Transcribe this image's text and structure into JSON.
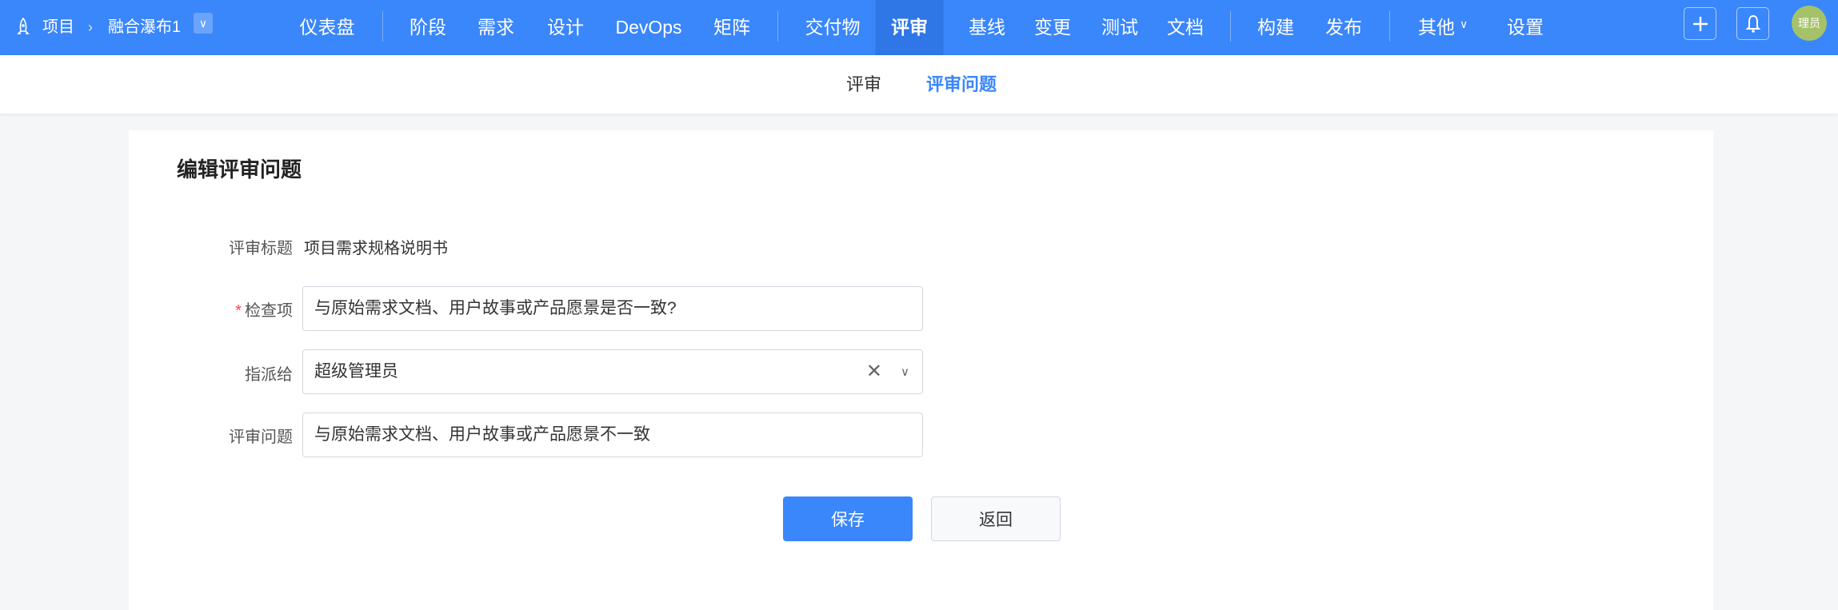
{
  "nav": {
    "project_label": "项目",
    "project_name": "融合瀑布1",
    "items": [
      "仪表盘",
      "阶段",
      "需求",
      "设计",
      "DevOps",
      "矩阵",
      "交付物",
      "评审",
      "基线",
      "变更",
      "测试",
      "文档",
      "构建",
      "发布",
      "其他",
      "设置"
    ],
    "active": "评审",
    "avatar_text": "理员"
  },
  "subnav": {
    "tabs": [
      "评审",
      "评审问题"
    ],
    "active": "评审问题"
  },
  "form": {
    "title": "编辑评审问题",
    "review_title_label": "评审标题",
    "review_title_value": "项目需求规格说明书",
    "required_mark": "*",
    "check_item_label": "检查项",
    "check_item_value": "与原始需求文档、用户故事或产品愿景是否一致?",
    "assignee_label": "指派给",
    "assignee_value": "超级管理员",
    "issue_label": "评审问题",
    "issue_value": "与原始需求文档、用户故事或产品愿景不一致",
    "save_label": "保存",
    "back_label": "返回"
  },
  "colors": {
    "primary": "#3a86fb",
    "avatar": "#a5c26b"
  }
}
